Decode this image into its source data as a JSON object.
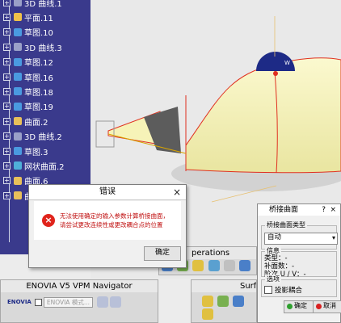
{
  "tree": {
    "items": [
      {
        "label": "3D 曲线.1",
        "icon_color": "#9aa0c8"
      },
      {
        "label": "平面.11",
        "icon_color": "#f0c24a"
      },
      {
        "label": "草图.10",
        "icon_color": "#4a9ae0"
      },
      {
        "label": "3D 曲线.3",
        "icon_color": "#9aa0c8"
      },
      {
        "label": "草图.12",
        "icon_color": "#4a9ae0"
      },
      {
        "label": "草图.16",
        "icon_color": "#4a9ae0"
      },
      {
        "label": "草图.18",
        "icon_color": "#4a9ae0"
      },
      {
        "label": "草图.19",
        "icon_color": "#4a9ae0"
      },
      {
        "label": "曲面.2",
        "icon_color": "#e8c05a"
      },
      {
        "label": "3D 曲线.2",
        "icon_color": "#9aa0c8"
      },
      {
        "label": "草图.3",
        "icon_color": "#4a9ae0"
      },
      {
        "label": "网状曲面.2",
        "icon_color": "#4fb0d8"
      },
      {
        "label": "曲面.6",
        "icon_color": "#e8c05a"
      },
      {
        "label": "曲面.4",
        "icon_color": "#e8c05a"
      }
    ]
  },
  "error_dialog": {
    "title": "错误",
    "close": "×",
    "icon": "×",
    "message_line1": "无法使用确定的输入参数计算桥接曲面，",
    "message_line2": "请尝试更改连续性或更改耦合点的位置",
    "ok_label": "确定"
  },
  "blend_dialog": {
    "title": "桥接曲面",
    "help": "?",
    "close": "×",
    "type_group": "桥接曲面类型",
    "type_value": "自动",
    "info_group": "信息",
    "info_type": "类型：-",
    "info_patches": "补面数：-",
    "info_order": "阶次 U / V：-",
    "options_group": "选项",
    "display_coupling": "投影耦合",
    "ok_label": "确定",
    "cancel_label": "取消"
  },
  "toolbars": {
    "operations_title": "perations",
    "enovia_title": "ENOVIA V5 VPM Navigator",
    "enovia_logo": "ENOVIA",
    "enovia_field": "ENOVIA 模式...",
    "surf_title": "Surf"
  },
  "viewport": {
    "coupling_label": "W"
  },
  "colors": {
    "tree_bg": "#3a3a8c",
    "surface_fill": "#f6f3b8",
    "edge_red": "#e03020",
    "error_red": "#e0241c"
  }
}
